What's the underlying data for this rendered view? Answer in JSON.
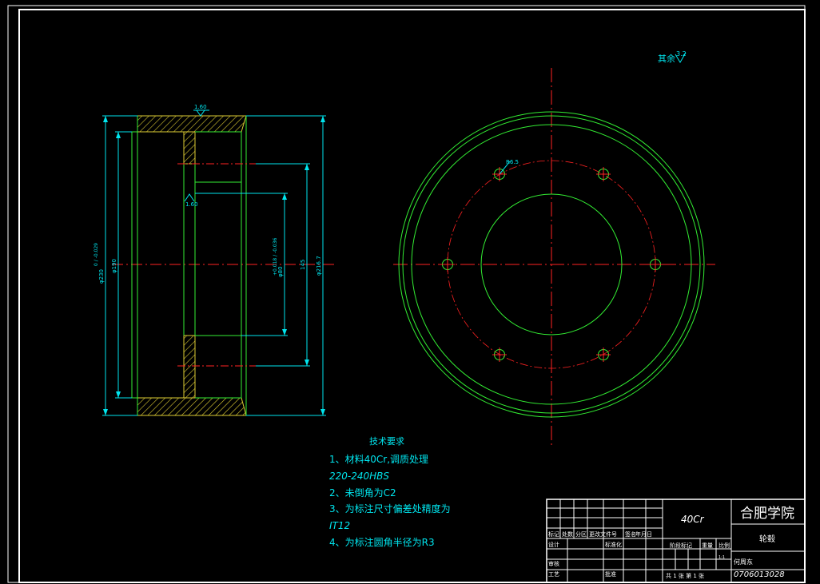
{
  "roughness_note": {
    "label": "其余",
    "value": "3.2"
  },
  "side_view": {
    "roughness_top": "1.60",
    "roughness_left": "1.60",
    "dim_outer": "φ230",
    "dim_outer_tol": "0 / -0.029",
    "dim_inner": "φ190",
    "dim_bore": "φ80",
    "dim_bore_tol": "+0.018 / -0.036",
    "dim_bolt": "145",
    "dim_rim": "φ216.7"
  },
  "front_view": {
    "hole_label": "R6.5"
  },
  "tech_requirements": {
    "title": "技术要求",
    "lines": [
      "1、材料40Cr,调质处理",
      "220-240HBS",
      "2、未倒角为C2",
      "3、为标注尺寸偏差处精度为",
      "IT12",
      "4、为标注圆角半径为R3"
    ]
  },
  "title_block": {
    "material": "40Cr",
    "school": "合肥学院",
    "part_name": "轮毂",
    "student_name": "何周东",
    "student_id": "0706013028",
    "row_labels": [
      "标记",
      "处数",
      "分区",
      "更改文件号",
      "签名",
      "年月日"
    ],
    "design": "设计",
    "standardize": "标准化",
    "check": "审核",
    "process": "工艺",
    "approve": "批准",
    "stage_mark": "阶段标记",
    "weight": "重量",
    "scale": "比例",
    "scale_value": "1:1",
    "sheets": "共 1 张 第 1 张"
  },
  "colors": {
    "background": "#000000",
    "frame": "#ffffff",
    "geometry": "#33ee33",
    "dimension": "#00e5ee",
    "centerline": "#ff2222",
    "hatch": "#ddcc33"
  }
}
